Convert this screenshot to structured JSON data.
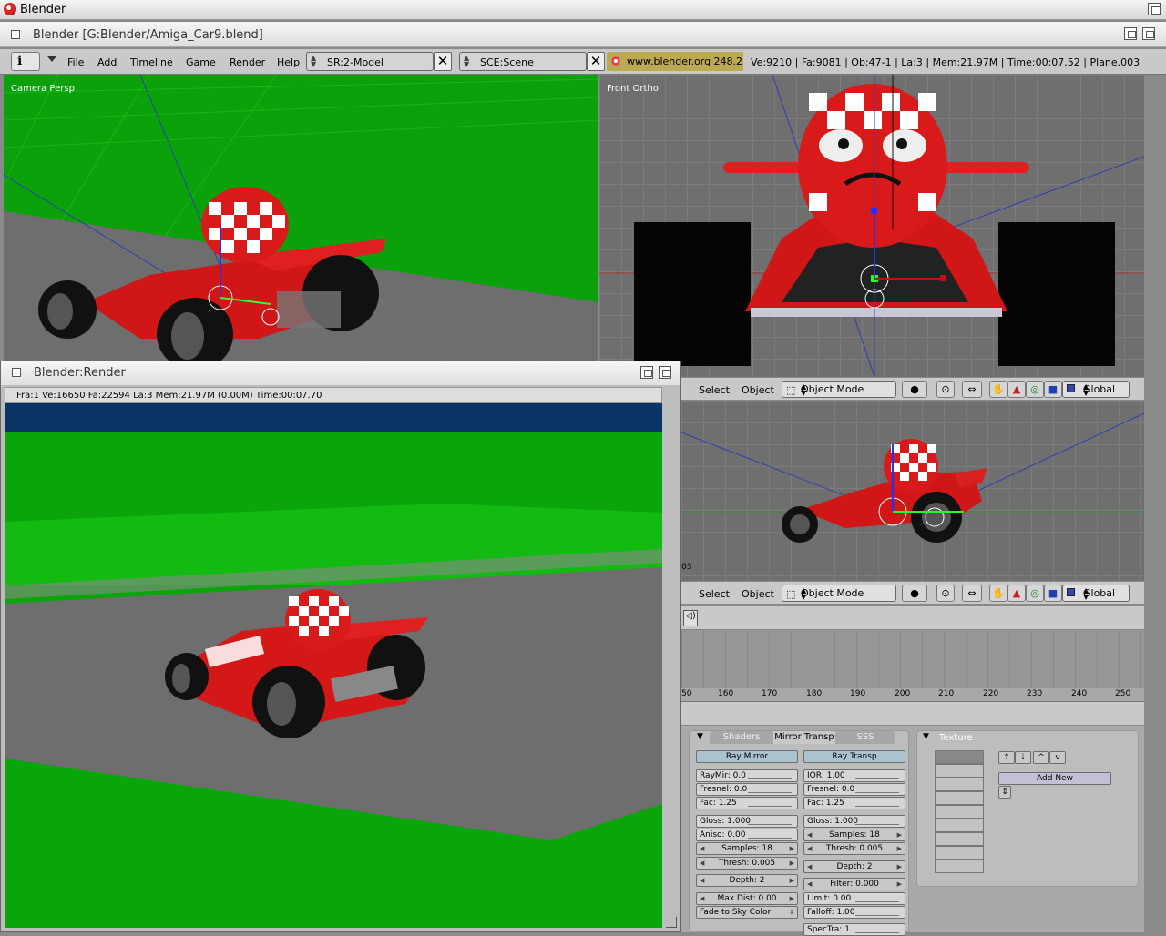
{
  "os": {
    "title": "Blender"
  },
  "window": {
    "title": "Blender [G:Blender/Amiga_Car9.blend]"
  },
  "header": {
    "menus": [
      "File",
      "Add",
      "Timeline",
      "Game",
      "Render",
      "Help"
    ],
    "screen": "SR:2-Model",
    "scene": "SCE:Scene",
    "url": "www.blender.org 248.2",
    "stats": "Ve:9210 | Fa:9081 | Ob:47-1 | La:3  | Mem:21.97M  | Time:00:07.52 | Plane.003"
  },
  "viewports": {
    "camera_label": "Camera Persp",
    "front_label": "Front Ortho",
    "side_label": "",
    "frag_03_a": "03",
    "frag_03_b": "03"
  },
  "vp_header": {
    "select": "Select",
    "object": "Object",
    "mode": "Object Mode",
    "orientation": "Global"
  },
  "render": {
    "title": "Blender:Render",
    "stats": "Fra:1  Ve:16650 Fa:22594 La:3 Mem:21.97M (0.00M) Time:00:07.70"
  },
  "timeline": {
    "frame_labels": [
      "50",
      "160",
      "170",
      "180",
      "190",
      "200",
      "210",
      "220",
      "230",
      "240",
      "250"
    ]
  },
  "buttons": {
    "tabs": [
      "Shaders",
      "Mirror Transp",
      "SSS"
    ],
    "texture_tab": "Texture",
    "ray_mirror": "Ray Mirror",
    "ray_transp": "Ray Transp",
    "raymir": "RayMir: 0.0",
    "fresnel_l": "Fresnel: 0.0",
    "fac_l": "Fac: 1.25",
    "gloss_l": "Gloss: 1.000",
    "aniso": "Aniso: 0.00",
    "samples_l": "Samples: 18",
    "thresh_l": "Thresh: 0.005",
    "depth_l": "Depth: 2",
    "maxdist": "Max Dist: 0.00",
    "fade": "Fade to Sky Color",
    "ior": "IOR: 1.00",
    "fresnel_r": "Fresnel: 0.0",
    "fac_r": "Fac: 1.25",
    "gloss_r": "Gloss: 1.000",
    "samples_r": "Samples: 18",
    "thresh_r": "Thresh: 0.005",
    "depth_r": "Depth: 2",
    "filter": "Filter: 0.000",
    "limit": "Limit: 0.00",
    "falloff": "Falloff: 1.00",
    "spectra": "SpecTra: 1",
    "add_new": "Add New"
  },
  "colors": {
    "ground_green": "#0ca00c",
    "road_gray": "#6d6d6d",
    "car_red": "#d41818",
    "render_sky": "#0b3566"
  }
}
